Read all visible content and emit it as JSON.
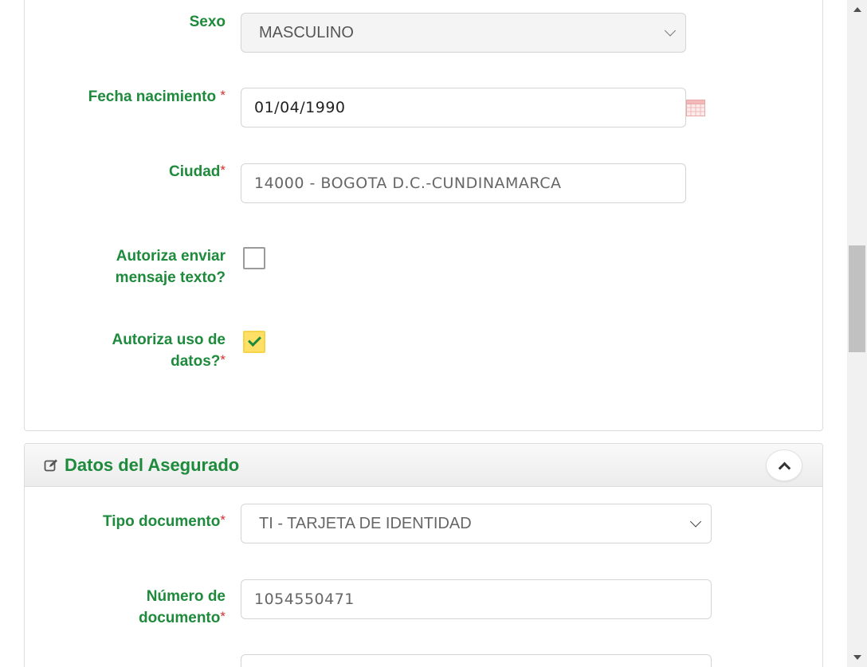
{
  "form_personal": {
    "sexo": {
      "label": "Sexo",
      "value": "MASCULINO"
    },
    "fecha_nacimiento": {
      "label": "Fecha nacimiento",
      "required_mark": "*",
      "value": "01/04/1990"
    },
    "ciudad": {
      "label": "Ciudad",
      "required_mark": "*",
      "value": "14000 - BOGOTA D.C.-CUNDINAMARCA"
    },
    "autoriza_mensaje": {
      "label_line1": "Autoriza enviar",
      "label_line2": "mensaje texto?",
      "checked": false
    },
    "autoriza_datos": {
      "label_line1": "Autoriza uso de",
      "label_line2": "datos?",
      "required_mark": "*",
      "checked": true
    }
  },
  "asegurado": {
    "title": "Datos del Asegurado",
    "tipo_documento": {
      "label": "Tipo documento",
      "required_mark": "*",
      "value": "TI - TARJETA DE IDENTIDAD"
    },
    "numero_documento": {
      "label_line1": "Número de",
      "label_line2": "documento",
      "required_mark": "*",
      "value": "1054550471"
    }
  },
  "icons": {
    "calendar": "calendar-icon",
    "edit": "edit-icon",
    "collapse": "chevron-up-icon",
    "select_arrow": "chevron-down-icon"
  },
  "colors": {
    "label_green": "#1e8a3c",
    "required_red": "#d63031",
    "checked_yellow": "#ffe066"
  }
}
